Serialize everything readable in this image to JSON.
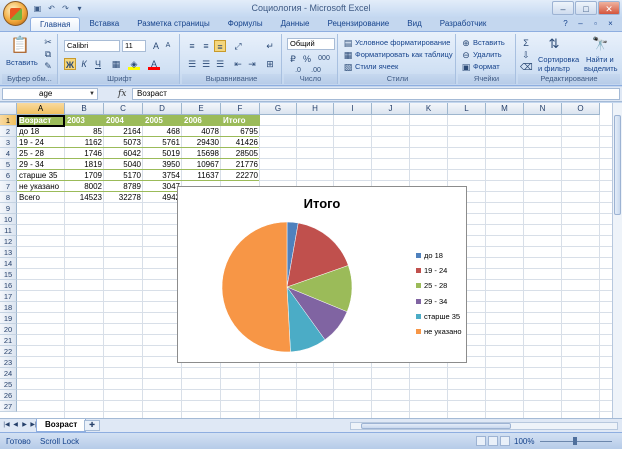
{
  "window": {
    "title": "Социология - Microsoft Excel",
    "controls": [
      "–",
      "□",
      "✕"
    ]
  },
  "ribbon": {
    "tabs": [
      "Главная",
      "Вставка",
      "Разметка страницы",
      "Формулы",
      "Данные",
      "Рецензирование",
      "Вид",
      "Разработчик"
    ],
    "active_tab": "Главная",
    "clipboard": {
      "label": "Буфер обм...",
      "paste": "Вставить"
    },
    "font": {
      "label": "Шрифт",
      "name": "Calibri",
      "size": "11",
      "bold": "Ж",
      "italic": "К",
      "underline": "Ч"
    },
    "alignment": {
      "label": "Выравнивание"
    },
    "number": {
      "label": "Число",
      "format": "Общий",
      "percent": "%",
      "thousands": "000"
    },
    "styles": {
      "label": "Стили",
      "conditional": "Условное форматирование",
      "as_table": "Форматировать как таблицу",
      "cell_styles": "Стили ячеек"
    },
    "cells": {
      "label": "Ячейки",
      "insert": "Вставить",
      "delete": "Удалить",
      "format": "Формат"
    },
    "editing": {
      "label": "Редактирование",
      "sort_line1": "Сортировка",
      "sort_line2": "и фильтр",
      "find_line1": "Найти и",
      "find_line2": "выделить"
    }
  },
  "formula_bar": {
    "name_box": "age",
    "fx": "fx",
    "content": "Возраст"
  },
  "columns": [
    "A",
    "B",
    "C",
    "D",
    "E",
    "F",
    "G",
    "H",
    "I",
    "J",
    "K",
    "L",
    "M",
    "N",
    "O"
  ],
  "rows": [
    "1",
    "2",
    "3",
    "4",
    "5",
    "6",
    "7",
    "8",
    "9",
    "10",
    "11",
    "12",
    "13",
    "14",
    "15",
    "16",
    "17",
    "18",
    "19",
    "20",
    "21",
    "22",
    "23",
    "24",
    "25",
    "26",
    "27"
  ],
  "table": {
    "header": [
      "Возраст",
      "2003",
      "2004",
      "2005",
      "2006",
      "Итого"
    ],
    "rows": [
      [
        "до 18",
        "85",
        "2164",
        "468",
        "4078",
        "6795"
      ],
      [
        "19 - 24",
        "1162",
        "5073",
        "5761",
        "29430",
        "41426"
      ],
      [
        "25 - 28",
        "1746",
        "6042",
        "5019",
        "15698",
        "28505"
      ],
      [
        "29 - 34",
        "1819",
        "5040",
        "3950",
        "10967",
        "21776"
      ],
      [
        "старше 35",
        "1709",
        "5170",
        "3754",
        "11637",
        "22270"
      ],
      [
        "не указано",
        "8002",
        "8789",
        "3047",
        "",
        ""
      ],
      [
        "Всего",
        "14523",
        "32278",
        "4942",
        "",
        ""
      ]
    ]
  },
  "chart_data": {
    "type": "pie",
    "title": "Итого",
    "categories": [
      "до 18",
      "19 - 24",
      "25 - 28",
      "29 - 34",
      "старше 35",
      "не указано"
    ],
    "values": [
      6795,
      41426,
      28505,
      21776,
      22270,
      125000
    ],
    "colors": [
      "#4f81bd",
      "#c0504d",
      "#9bbb59",
      "#8064a2",
      "#4bacc6",
      "#f79646"
    ],
    "legend": "right"
  },
  "sheets": {
    "active": "Возраст"
  },
  "status": {
    "ready": "Готово",
    "scroll_lock": "Scroll Lock",
    "zoom": "100%"
  }
}
